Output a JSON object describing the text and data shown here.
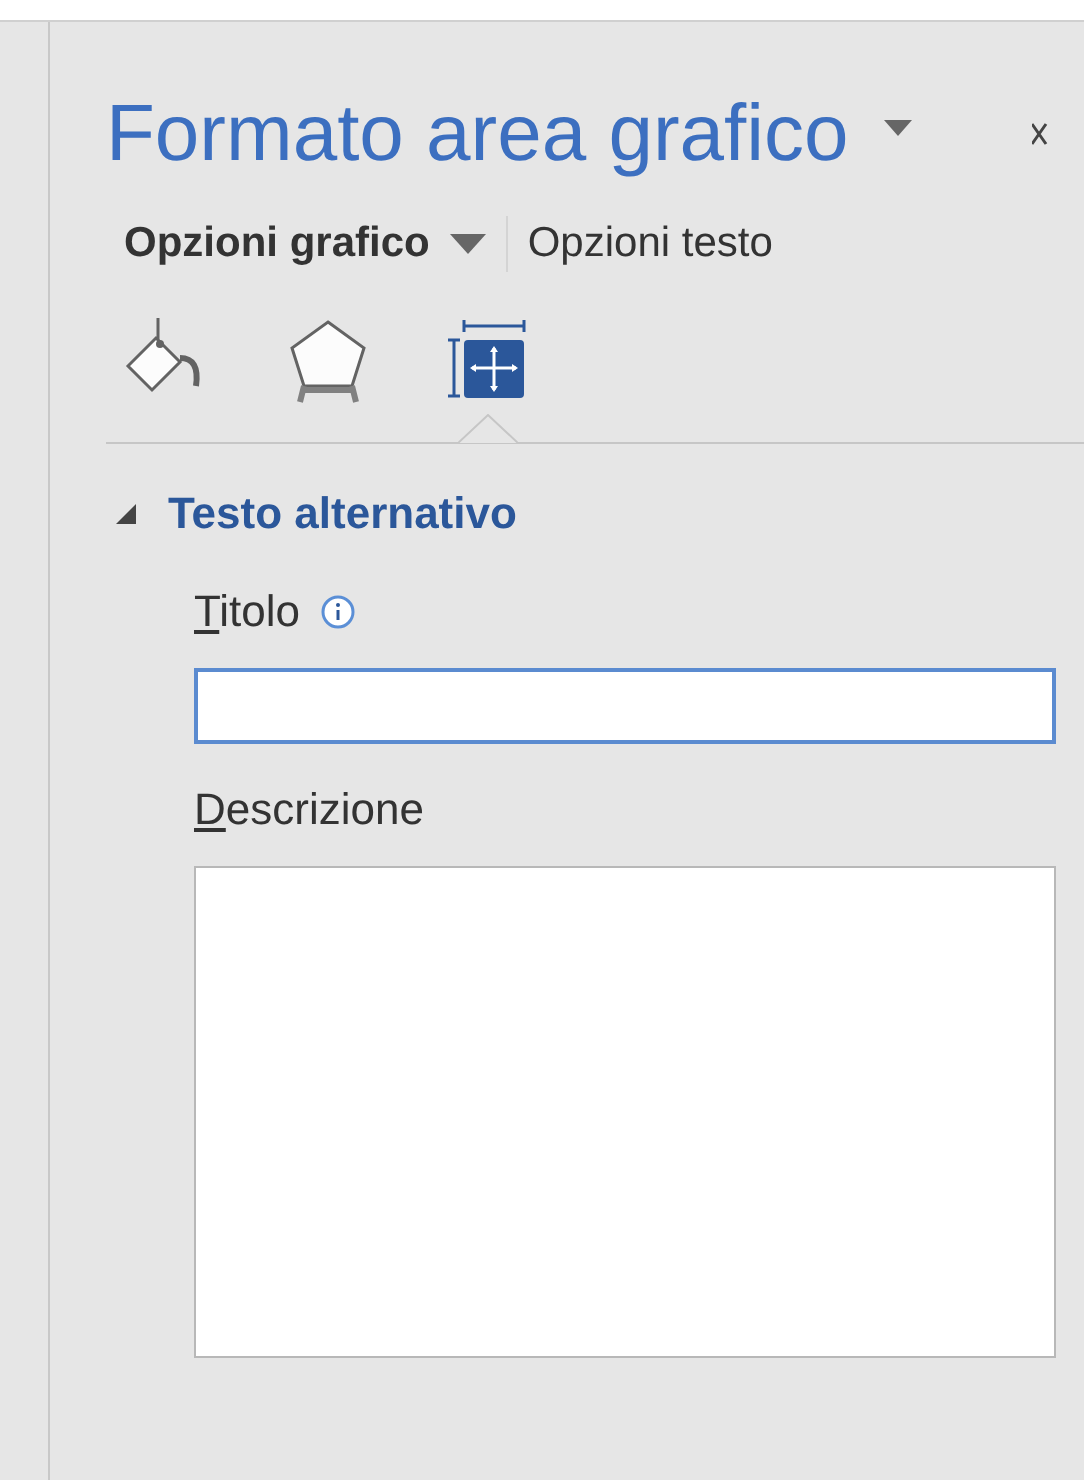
{
  "pane": {
    "title": "Formato area grafico"
  },
  "tabs": [
    {
      "label": "Opzioni grafico",
      "selected": true,
      "dropdown": true
    },
    {
      "label": "Opzioni testo",
      "selected": false,
      "dropdown": false
    }
  ],
  "icon_tabs": [
    {
      "kind": "fill",
      "selected": false
    },
    {
      "kind": "effects",
      "selected": false
    },
    {
      "kind": "size",
      "selected": true
    }
  ],
  "section": {
    "title": "Testo alternativo",
    "expanded": true,
    "fields": [
      {
        "kind": "input",
        "label": "Titolo",
        "info": true,
        "focused": true
      },
      {
        "kind": "textarea",
        "label": "Descrizione",
        "info": false,
        "focused": false
      }
    ]
  }
}
